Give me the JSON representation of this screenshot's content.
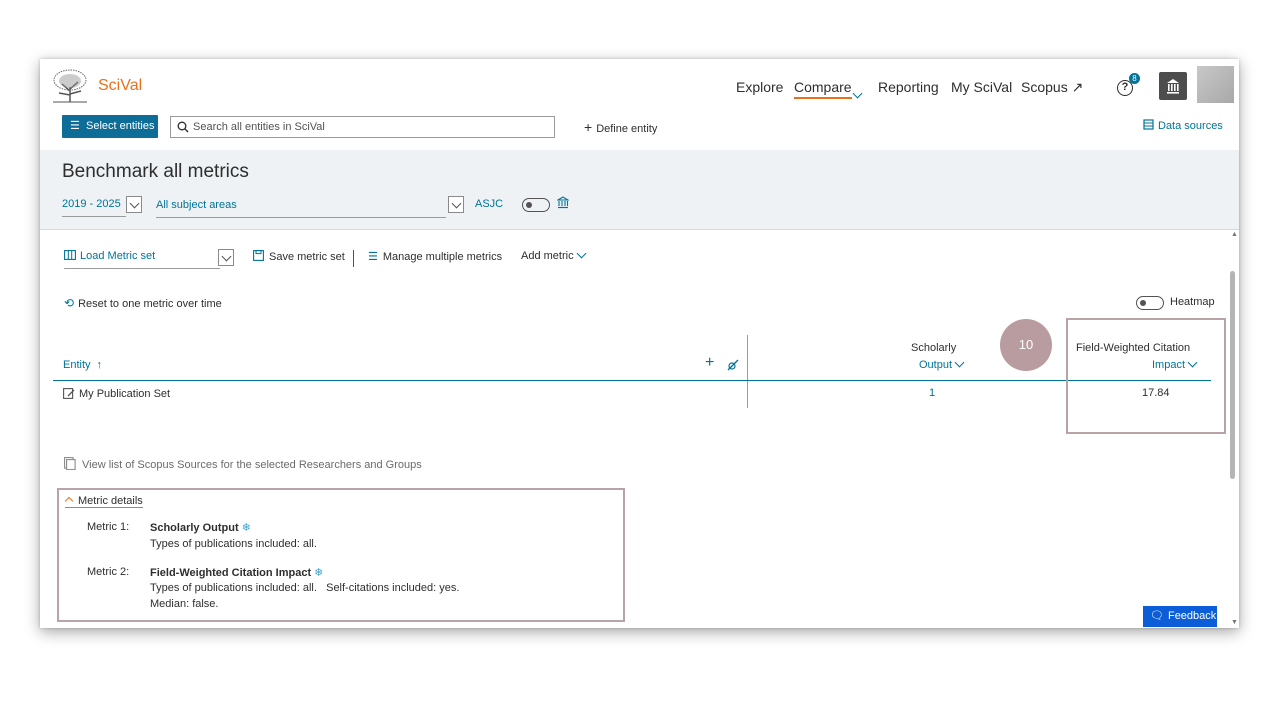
{
  "header": {
    "brand": "SciVal",
    "nav": [
      "Explore",
      "Compare",
      "Reporting",
      "My SciVal",
      "Scopus ↗"
    ],
    "help_badge": "8",
    "help_glyph": "?"
  },
  "toolbar": {
    "select_entities": "Select entities",
    "search_placeholder": "Search all entities in SciVal",
    "define_entity": "Define entity",
    "data_sources": "Data sources"
  },
  "page": {
    "title": "Benchmark all metrics",
    "year_range": "2019 - 2025",
    "subject": "All subject areas",
    "asjc": "ASJC"
  },
  "metrics_bar": {
    "load": "Load Metric set",
    "save": "Save metric set",
    "manage": "Manage multiple metrics",
    "add": "Add metric",
    "reset": "Reset to one metric over time",
    "heatmap": "Heatmap"
  },
  "table": {
    "entity_header": "Entity",
    "col1_header": [
      "Scholarly",
      "Output"
    ],
    "col2_header": [
      "Field-Weighted Citation",
      "Impact"
    ],
    "rows": [
      {
        "entity": "My Publication Set",
        "scholarly_output": "1",
        "fwci": "17.84"
      }
    ]
  },
  "annotation_badge": "10",
  "sources_link": "View list of Scopus Sources for the selected Researchers and Groups",
  "metric_details": {
    "toggle": "Metric details",
    "items": [
      {
        "label": "Metric 1:",
        "name": "Scholarly Output",
        "lines": [
          "Types of publications included: all."
        ]
      },
      {
        "label": "Metric 2:",
        "name": "Field-Weighted Citation Impact",
        "lines": [
          "Types of publications included: all.   Self-citations included: yes.",
          "Median: false."
        ]
      }
    ]
  },
  "feedback": "Feedback",
  "colors": {
    "accent": "#e9711c",
    "teal": "#007398",
    "highlight": "#b8a4a6",
    "feedback": "#0b5ed7"
  }
}
